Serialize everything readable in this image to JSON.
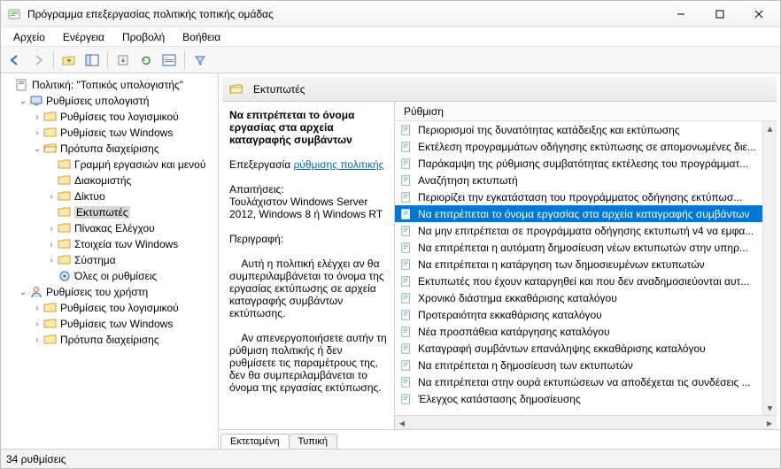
{
  "window": {
    "title": "Πρόγραμμα επεξεργασίας πολιτικής τοπικής ομάδας"
  },
  "menu": {
    "file": "Αρχείο",
    "action": "Ενέργεια",
    "view": "Προβολή",
    "help": "Βοήθεια"
  },
  "tree": {
    "root": "Πολιτική: \"Τοπικός υπολογιστής\"",
    "cc": "Ρυθμίσεις υπολογιστή",
    "cc_sw": "Ρυθμίσεις του λογισμικού",
    "cc_win": "Ρυθμίσεις των Windows",
    "cc_at": "Πρότυπα διαχείρισης",
    "cc_at_taskbar": "Γραμμή εργασιών και μενού",
    "cc_at_server": "Διακομιστής",
    "cc_at_network": "Δίκτυο",
    "cc_at_printers": "Εκτυπωτές",
    "cc_at_cp": "Πίνακας Ελέγχου",
    "cc_at_wincomp": "Στοιχεία των Windows",
    "cc_at_system": "Σύστημα",
    "cc_at_all": "Όλες οι ρυθμίσεις",
    "uc": "Ρυθμίσεις του χρήστη",
    "uc_sw": "Ρυθμίσεις του λογισμικού",
    "uc_win": "Ρυθμίσεις των Windows",
    "uc_at": "Πρότυπα διαχείρισης"
  },
  "header": "Εκτυπωτές",
  "desc": {
    "title": "Να επιτρέπεται το όνομα εργασίας στα αρχεία καταγραφής συμβάντων",
    "edit_label": "Επεξεργασία",
    "edit_link": "ρύθμισης πολιτικής",
    "req_label": "Απαιτήσεις:",
    "req_text": "Τουλάχιστον Windows Server 2012, Windows 8 ή Windows RT",
    "desc_label": "Περιγραφή:",
    "desc_p1": "    Αυτή η πολιτική ελέγχει αν θα συμπεριλαμβάνεται το όνομα της εργασίας εκτύπωσης σε αρχεία καταγραφής συμβάντων εκτύπωσης.",
    "desc_p2": "    Αν απενεργοποιήσετε αυτήν τη ρύθμιση πολιτικής ή δεν ρυθμίσετε τις παραμέτρους της, δεν θα συμπεριλαμβάνεται το όνομα της εργασίας εκτύπωσης."
  },
  "list": {
    "header": "Ρύθμιση",
    "items": [
      "Περιορισμοί της δυνατότητας κατάδειξης και εκτύπωσης",
      "Εκτέλεση προγραμμάτων οδήγησης εκτύπωσης σε απομονωμένες διε...",
      "Παράκαμψη της ρύθμισης συμβατότητας εκτέλεσης του προγράμματ...",
      "Αναζήτηση εκτυπωτή",
      "Περιορίζει την εγκατάσταση του προγράμματος οδήγησης εκτύπωσ...",
      "Να επιτρέπεται το όνομα εργασίας στα αρχεία καταγραφής συμβάντων",
      "Να μην επιτρέπεται σε προγράμματα οδήγησης εκτυπωτή v4 να εμφα...",
      "Να επιτρέπεται η αυτόματη δημοσίευση νέων εκτυπωτών στην υπηρ...",
      "Να επιτρέπεται η κατάργηση των δημοσιευμένων εκτυπωτών",
      "Εκτυπωτές που έχουν καταργηθεί και που δεν αναδημοσιεύονται αυτ...",
      "Χρονικό διάστημα εκκαθάρισης καταλόγου",
      "Προτεραιότητα εκκαθάρισης καταλόγου",
      "Νέα προσπάθεια κατάργησης καταλόγου",
      "Καταγραφή συμβάντων επανάληψης εκκαθάρισης καταλόγου",
      "Να επιτρέπεται η δημοσίευση των εκτυπωτών",
      "Να επιτρέπεται στην ουρά εκτυπώσεων να αποδέχεται τις συνδέσεις ...",
      "Έλεγχος κατάστασης δημοσίευσης"
    ],
    "selected_index": 5
  },
  "tabs": {
    "extended": "Εκτεταμένη",
    "standard": "Τυπική"
  },
  "status": "34 ρυθμίσεις"
}
